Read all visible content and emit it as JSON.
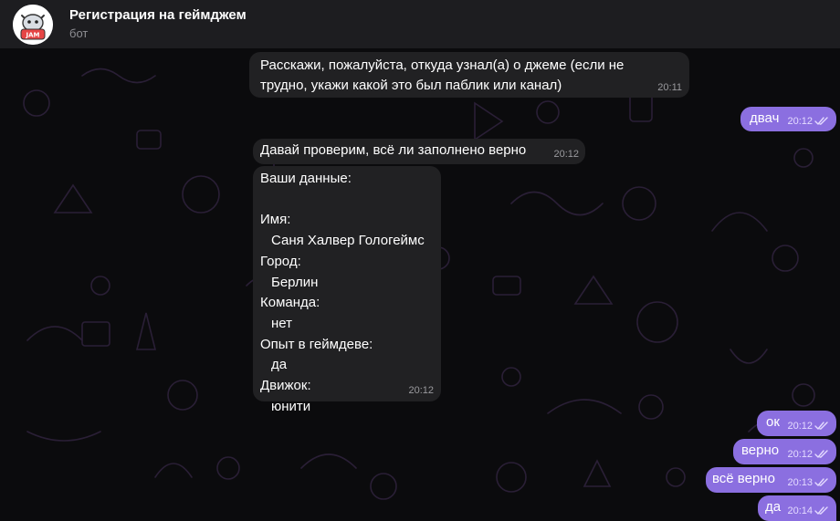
{
  "header": {
    "title": "Регистрация на геймджем",
    "subtitle": "бот",
    "avatar_logo_text": "JAM"
  },
  "colors": {
    "header_bg": "#1d1d20",
    "incoming_bubble": "#212123",
    "outgoing_bubble": "#8b6fe0",
    "wallpaper_doodle": "#2a1f36"
  },
  "messages": [
    {
      "direction": "incoming",
      "lines": [
        "Расскажи, пожалуйста, откуда узнал(а) о джеме (если не",
        "трудно, укажи какой это был паблик или канал)"
      ],
      "time": "20:11"
    },
    {
      "direction": "outgoing",
      "text": "двач",
      "time": "20:12",
      "status_icon": "double-check-icon"
    },
    {
      "direction": "incoming",
      "text": "Давай проверим, всё ли заполнено верно",
      "time": "20:12"
    },
    {
      "direction": "incoming",
      "time": "20:12",
      "summary": {
        "heading": "Ваши данные:",
        "fields": [
          {
            "label": "Имя:",
            "value": "Саня Халвер Гологеймс"
          },
          {
            "label": "Город:",
            "value": "Берлин"
          },
          {
            "label": "Команда:",
            "value": "нет"
          },
          {
            "label": "Опыт в геймдеве:",
            "value": "да"
          },
          {
            "label": "Движок:",
            "value": "юнити"
          }
        ]
      }
    },
    {
      "direction": "outgoing",
      "text": "ок",
      "time": "20:12",
      "status_icon": "double-check-icon"
    },
    {
      "direction": "outgoing",
      "text": "верно",
      "time": "20:12",
      "status_icon": "double-check-icon"
    },
    {
      "direction": "outgoing",
      "text": "всё верно",
      "time": "20:13",
      "status_icon": "double-check-icon"
    },
    {
      "direction": "outgoing",
      "text": "да",
      "time": "20:14",
      "status_icon": "double-check-icon"
    }
  ]
}
